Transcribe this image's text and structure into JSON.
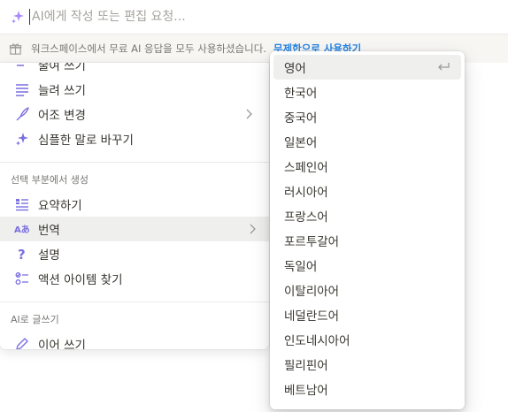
{
  "ai_bar": {
    "placeholder": "AI에게 작성 또는 편집 요청...",
    "icon": "sparkle-icon",
    "accent_color": "#a78bfa"
  },
  "notice": {
    "text": "워크스페이스에서 무료 AI 응답을 모두 사용하셨습니다.",
    "link": "무제한으로 사용하기",
    "link_color": "#2383e2"
  },
  "menu": {
    "items_top": [
      {
        "label": "줄여 쓰기",
        "icon": "short-lines-icon"
      },
      {
        "label": "늘려 쓰기",
        "icon": "long-lines-icon"
      },
      {
        "label": "어조 변경",
        "icon": "quill-icon",
        "has_submenu": true
      },
      {
        "label": "심플한 말로 바꾸기",
        "icon": "sparkle-icon"
      }
    ],
    "section_selection": "선택 부분에서 생성",
    "items_selection": [
      {
        "label": "요약하기",
        "icon": "summary-icon"
      },
      {
        "label": "번역",
        "icon": "translate-icon",
        "has_submenu": true,
        "active": true
      },
      {
        "label": "설명",
        "icon": "question-icon"
      },
      {
        "label": "액션 아이템 찾기",
        "icon": "checklist-icon"
      }
    ],
    "section_write": "AI로 글쓰기",
    "items_write": [
      {
        "label": "이어 쓰기",
        "icon": "pencil-icon"
      }
    ]
  },
  "languages": {
    "selected": "영어",
    "items": [
      "영어",
      "한국어",
      "중국어",
      "일본어",
      "스페인어",
      "러시아어",
      "프랑스어",
      "포르투갈어",
      "독일어",
      "이탈리아어",
      "네덜란드어",
      "인도네시아어",
      "필리핀어",
      "베트남어"
    ]
  }
}
